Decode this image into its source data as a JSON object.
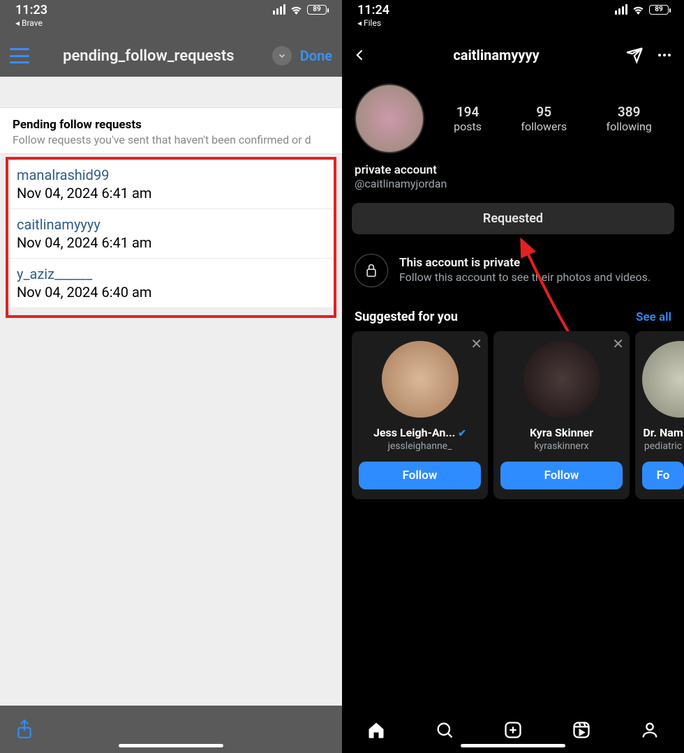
{
  "left": {
    "status": {
      "time": "11:23",
      "back_app": "◂ Brave",
      "battery": "89"
    },
    "nav": {
      "title": "pending_follow_requests",
      "done": "Done"
    },
    "section": {
      "title": "Pending follow requests",
      "subtitle": "Follow requests you've sent that haven't been confirmed or d"
    },
    "items": [
      {
        "user": "manalrashid99",
        "date": "Nov 04, 2024 6:41 am"
      },
      {
        "user": "caitlinamyyyy",
        "date": "Nov 04, 2024 6:41 am"
      },
      {
        "user": "y_aziz______",
        "date": "Nov 04, 2024 6:40 am"
      }
    ]
  },
  "right": {
    "status": {
      "time": "11:24",
      "back_app": "◂ Files",
      "battery": "89"
    },
    "nav": {
      "title": "caitlinamyyyy"
    },
    "stats": [
      {
        "num": "194",
        "label": "posts"
      },
      {
        "num": "95",
        "label": "followers"
      },
      {
        "num": "389",
        "label": "following"
      }
    ],
    "bio": {
      "line1": "private account",
      "line2": "@caitlinamyjordan"
    },
    "request_btn": "Requested",
    "private": {
      "title": "This account is private",
      "sub": "Follow this account to see their photos and videos."
    },
    "suggested": {
      "title": "Suggested for you",
      "see_all": "See all"
    },
    "cards": [
      {
        "name": "Jess Leigh-An...",
        "verified": true,
        "username": "jessleighanne_",
        "btn": "Follow"
      },
      {
        "name": "Kyra Skinner",
        "verified": false,
        "username": "kyraskinnerx",
        "btn": "Follow"
      },
      {
        "name": "Dr. Nam",
        "verified": false,
        "username": "pediatric",
        "btn": "Fo"
      }
    ]
  }
}
